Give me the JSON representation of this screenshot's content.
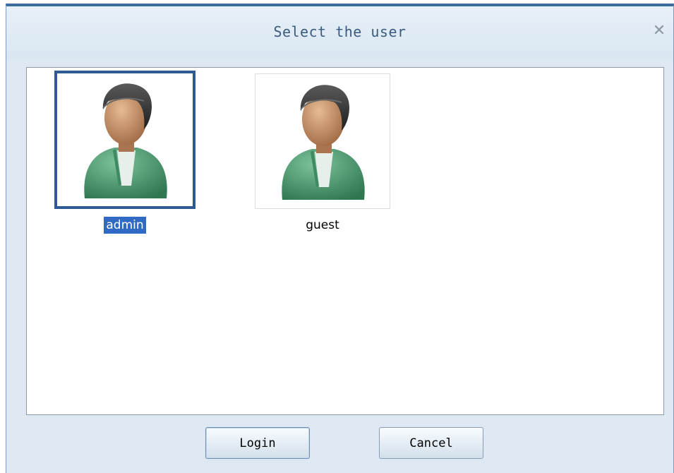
{
  "dialog": {
    "title": "Select the user",
    "close_icon": "close-icon"
  },
  "users": [
    {
      "name": "admin",
      "selected": true,
      "icon": "user-avatar-icon"
    },
    {
      "name": "guest",
      "selected": false,
      "icon": "user-avatar-icon"
    }
  ],
  "buttons": {
    "login_label": "Login",
    "cancel_label": "Cancel"
  },
  "colors": {
    "selection": "#316ac5",
    "selected_border": "#2e5a93",
    "title_text": "#3b5b7e",
    "shirt": "#4f9a72",
    "skin": "#c8946a",
    "hair": "#2d2d2d"
  }
}
